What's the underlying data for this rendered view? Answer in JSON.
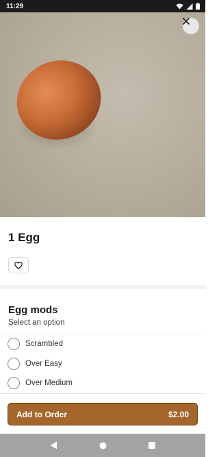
{
  "status_bar": {
    "time": "11:29",
    "icons": [
      "wifi-icon",
      "cellular-signal-icon",
      "battery-icon"
    ]
  },
  "hero": {
    "image_subject": "brown egg on a light brown surface",
    "close_icon": "close-icon"
  },
  "item": {
    "title": "1 Egg",
    "favorite_icon": "heart-outline-icon"
  },
  "modifiers": {
    "title": "Egg mods",
    "subtitle": "Select an option",
    "options": [
      {
        "label": "Scrambled",
        "selected": false
      },
      {
        "label": "Over Easy",
        "selected": false
      },
      {
        "label": "Over Medium",
        "selected": false
      }
    ]
  },
  "footer": {
    "button_label": "Add to Order",
    "price": "$2.00"
  },
  "nav": {
    "icons": [
      "back-icon",
      "home-icon",
      "recents-icon"
    ]
  },
  "colors": {
    "accent": "#a4662b",
    "status_bar": "#1b1b1b",
    "nav_bar": "#a3a3a3"
  }
}
